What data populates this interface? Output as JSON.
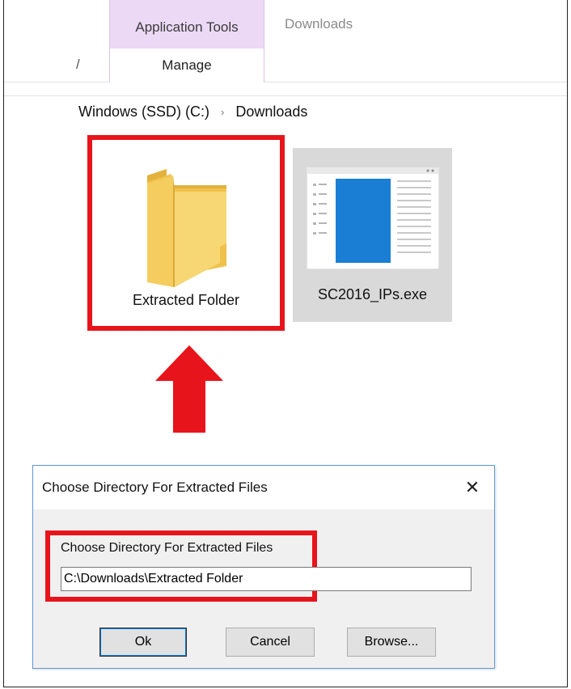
{
  "ribbon": {
    "context_tab_label": "Application Tools",
    "downloads_label": "Downloads",
    "manage_label": "Manage",
    "left_glyph": "/"
  },
  "address_bar": {
    "crumbs": [
      "Windows (SSD) (C:)",
      "Downloads"
    ],
    "separator": "›"
  },
  "files": [
    {
      "name": "Extracted Folder",
      "icon": "folder-icon"
    },
    {
      "name": "SC2016_IPs.exe",
      "icon": "application-exe-icon"
    }
  ],
  "dialog": {
    "title": "Choose Directory For Extracted Files",
    "close_glyph": "✕",
    "field_label": "Choose Directory For Extracted Files",
    "path_value": "C:\\Downloads\\Extracted Folder",
    "buttons": {
      "ok": "Ok",
      "cancel": "Cancel",
      "browse": "Browse..."
    }
  },
  "colors": {
    "highlight": "#e8141b",
    "context_tab": "#ecd9f5",
    "folder": "#f3cd5c",
    "exe_blue": "#1a7fd4"
  }
}
